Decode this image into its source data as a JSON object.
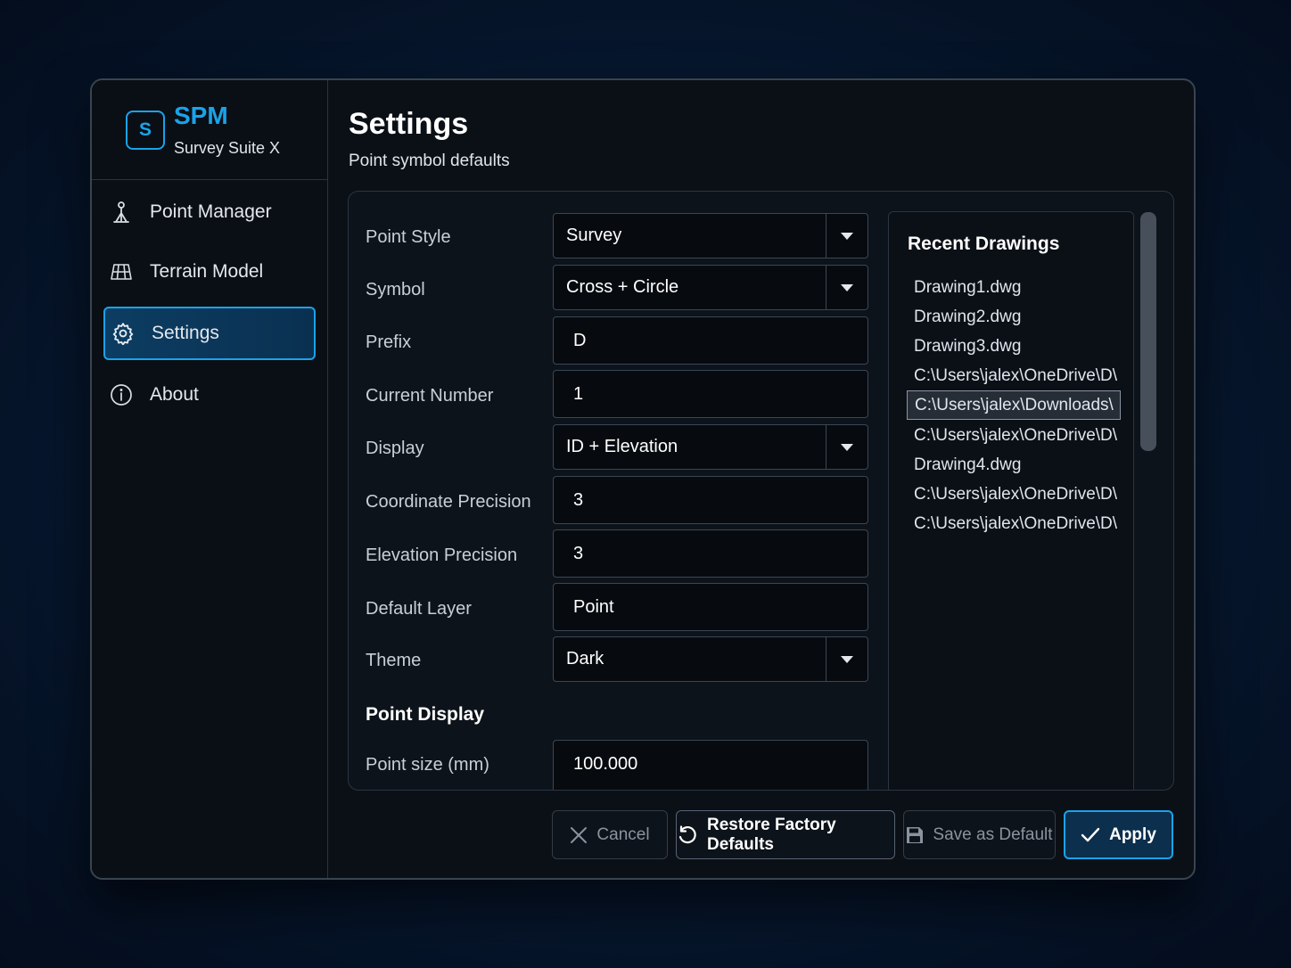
{
  "brand": {
    "logo_letter": "S",
    "name": "SPM",
    "subtitle": "Survey Suite X"
  },
  "sidebar": {
    "items": [
      {
        "label": "Point Manager",
        "icon": "surveyor-icon"
      },
      {
        "label": "Terrain Model",
        "icon": "grid-icon"
      },
      {
        "label": "Settings",
        "icon": "gear-icon",
        "active": true
      },
      {
        "label": "About",
        "icon": "info-icon"
      }
    ]
  },
  "header": {
    "title": "Settings",
    "subtitle": "Point symbol defaults"
  },
  "form": {
    "point_style": {
      "label": "Point Style",
      "value": "Survey"
    },
    "symbol": {
      "label": "Symbol",
      "value": "Cross + Circle"
    },
    "prefix": {
      "label": "Prefix",
      "value": "D"
    },
    "current_number": {
      "label": "Current Number",
      "value": "1"
    },
    "display": {
      "label": "Display",
      "value": "ID + Elevation"
    },
    "coordinate_precision": {
      "label": "Coordinate Precision",
      "value": "3"
    },
    "elevation_precision": {
      "label": "Elevation Precision",
      "value": "3"
    },
    "default_layer": {
      "label": "Default Layer",
      "value": "Point"
    },
    "theme": {
      "label": "Theme",
      "value": "Dark"
    },
    "section_point_display": "Point Display",
    "point_size": {
      "label": "Point size (mm)",
      "value": "100.000"
    }
  },
  "recent": {
    "title": "Recent Drawings",
    "items": [
      "Drawing1.dwg",
      "Drawing2.dwg",
      "Drawing3.dwg",
      "C:\\Users\\jalex\\OneDrive\\D\\",
      "C:\\Users\\jalex\\Downloads\\",
      "C:\\Users\\jalex\\OneDrive\\D\\",
      "Drawing4.dwg",
      "C:\\Users\\jalex\\OneDrive\\D\\",
      "C:\\Users\\jalex\\OneDrive\\D\\"
    ],
    "selected_index": 4
  },
  "buttons": {
    "cancel": "Cancel",
    "restore": "Restore Factory Defaults",
    "save_default": "Save as Default",
    "apply": "Apply"
  },
  "colors": {
    "accent": "#1aa3ea",
    "background": "#0b1016"
  }
}
